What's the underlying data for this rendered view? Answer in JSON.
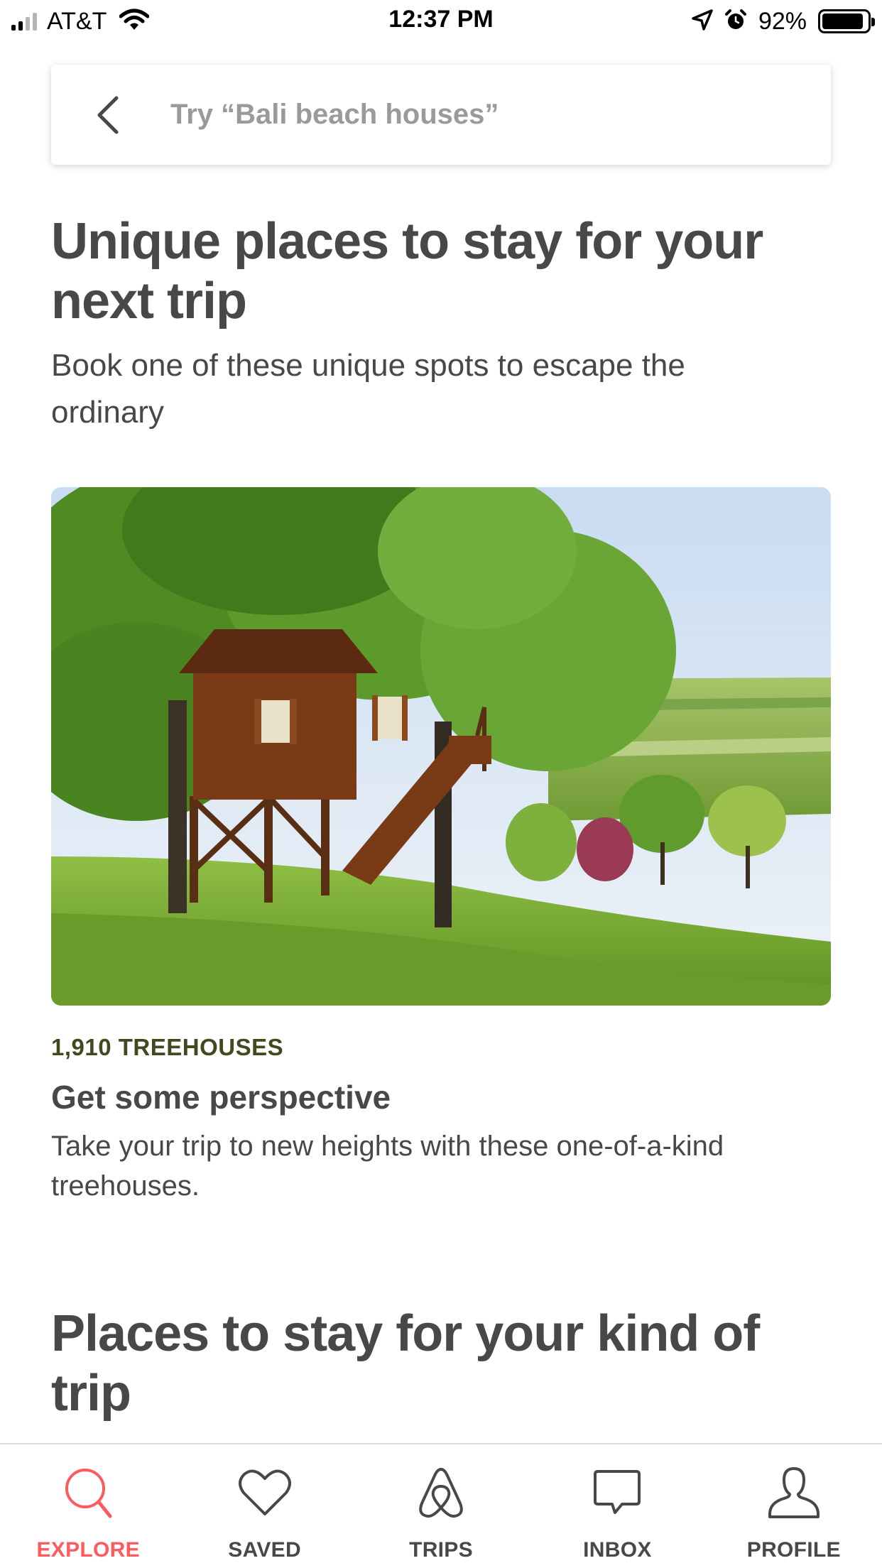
{
  "status_bar": {
    "carrier": "AT&T",
    "time": "12:37 PM",
    "battery": "92%",
    "battery_level": 0.92,
    "icons": [
      "signal-icon",
      "wifi-icon",
      "location-icon",
      "alarm-icon",
      "battery-icon"
    ]
  },
  "search": {
    "placeholder": "Try “Bali beach houses”",
    "icon": "back-chevron-icon"
  },
  "section_unique": {
    "title": "Unique places to stay for your next trip",
    "subtitle": "Book one of these unique spots to escape the ordinary"
  },
  "card": {
    "image": "treehouse-photo",
    "kicker": "1,910 TREEHOUSES",
    "kicker_color": "#3f4a1f",
    "title": "Get some perspective",
    "description": "Take your trip to new heights with these one-of-a-kind treehouses."
  },
  "section_kind": {
    "title": "Places to stay for your kind of trip"
  },
  "tab_bar": {
    "active_color": "#ff5a5f",
    "tabs": [
      {
        "label": "EXPLORE",
        "icon": "search-icon",
        "active": true
      },
      {
        "label": "SAVED",
        "icon": "heart-icon",
        "active": false
      },
      {
        "label": "TRIPS",
        "icon": "airbnb-logo-icon",
        "active": false
      },
      {
        "label": "INBOX",
        "icon": "chat-bubble-icon",
        "active": false
      },
      {
        "label": "PROFILE",
        "icon": "person-icon",
        "active": false
      }
    ]
  }
}
